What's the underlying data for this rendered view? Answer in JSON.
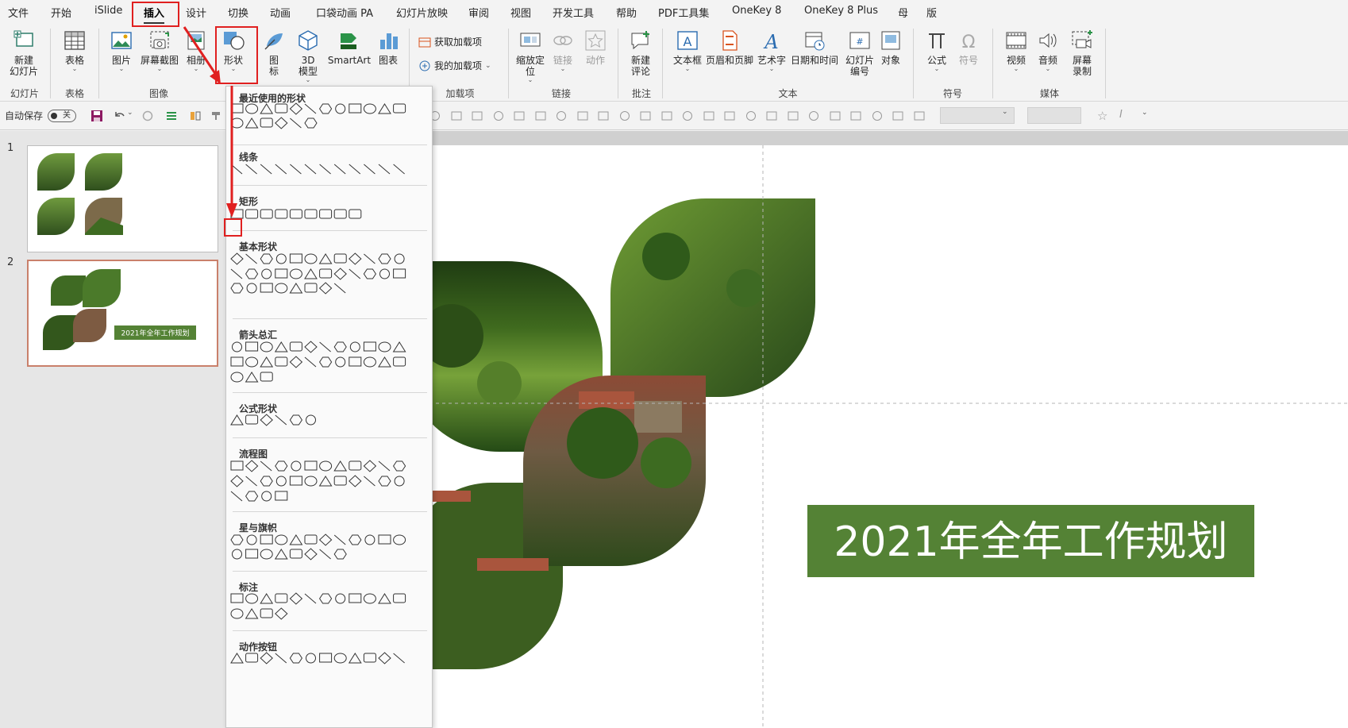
{
  "menu": {
    "tabs": [
      "文件",
      "开始",
      "iSlide",
      "插入",
      "设计",
      "切换",
      "动画",
      "口袋动画 PA",
      "幻灯片放映",
      "审阅",
      "视图",
      "开发工具",
      "帮助",
      "PDF工具集",
      "OneKey 8",
      "OneKey 8 Plus",
      "母",
      "版"
    ],
    "active_tab": "插入"
  },
  "ribbon": {
    "buttons": {
      "new_slide": "新建\n幻灯片",
      "table": "表格",
      "picture": "图片",
      "screenshot": "屏幕截图",
      "album": "相册",
      "shapes": "形状",
      "icons": "图\n标",
      "model3d": "3D\n模型",
      "smartart": "SmartArt",
      "chart": "图表",
      "get_addins": "获取加载项",
      "my_addins": "我的加载项",
      "zoom": "缩放定\n位",
      "link": "链接",
      "action": "动作",
      "new_comment": "新建\n评论",
      "textbox": "文本框",
      "header_footer": "页眉和页脚",
      "wordart": "艺术字",
      "datetime": "日期和时间",
      "slide_number": "幻灯片\n编号",
      "object": "对象",
      "equation": "公式",
      "symbol": "符号",
      "video": "视频",
      "audio": "音频",
      "screen_record": "屏幕\n录制"
    },
    "groups": {
      "slides": "幻灯片",
      "tables": "表格",
      "images": "图像",
      "addins": "加载项",
      "links": "链接",
      "comments": "批注",
      "text": "文本",
      "symbols": "符号",
      "media": "媒体"
    }
  },
  "qat": {
    "autosave_label": "自动保存",
    "autosave_state": "关"
  },
  "slides_panel": {
    "items": [
      {
        "number": "1"
      },
      {
        "number": "2",
        "banner": "2021年全年工作规划"
      }
    ]
  },
  "shapes_dropdown": {
    "sections": {
      "recent": "最近使用的形状",
      "lines": "线条",
      "rectangles": "矩形",
      "basic": "基本形状",
      "arrows": "箭头总汇",
      "equation": "公式形状",
      "flowchart": "流程图",
      "stars": "星与旗帜",
      "callouts": "标注",
      "action_buttons": "动作按钮"
    }
  },
  "slide": {
    "title": "2021年全年工作规划",
    "banner_color": "#548235"
  },
  "colors": {
    "highlight": "#e02020",
    "accent_green": "#548235"
  }
}
